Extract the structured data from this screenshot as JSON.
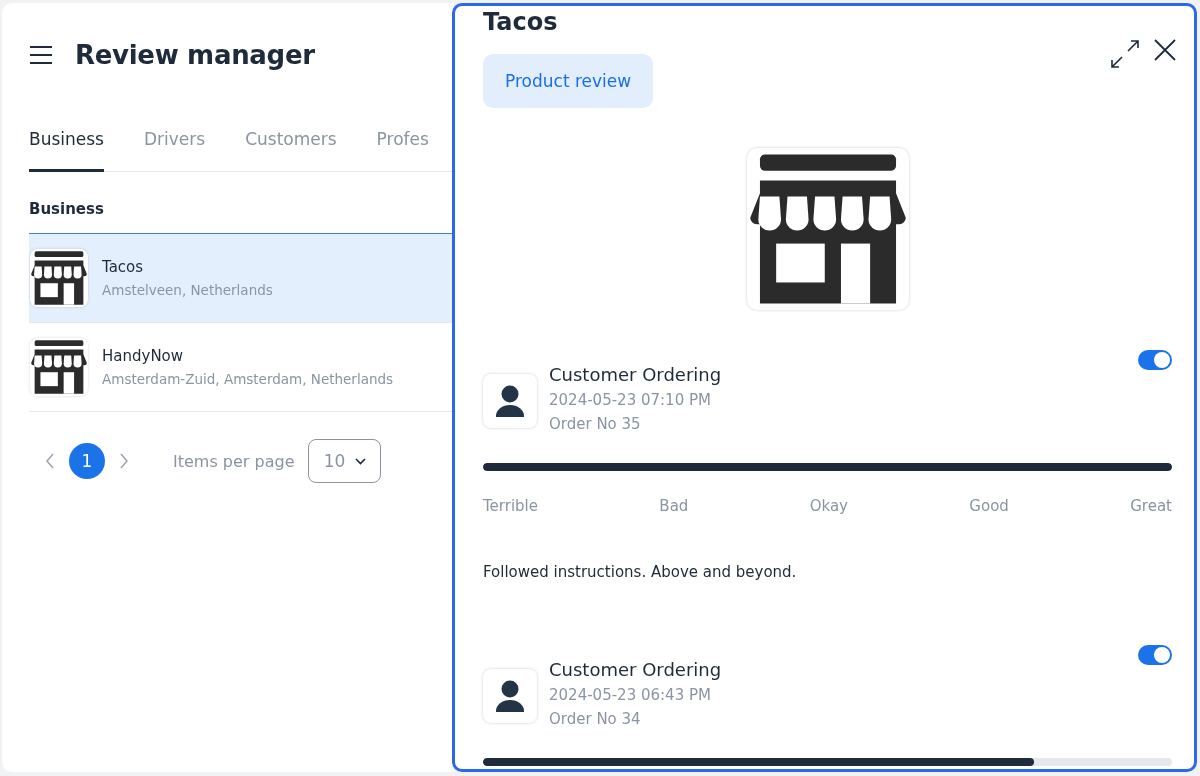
{
  "header": {
    "title": "Review manager"
  },
  "tabs": [
    {
      "label": "Business",
      "selected": true
    },
    {
      "label": "Drivers",
      "selected": false
    },
    {
      "label": "Customers",
      "selected": false
    },
    {
      "label": "Profes",
      "selected": false
    }
  ],
  "section_title": "Business",
  "businesses": [
    {
      "name": "Tacos",
      "location": "Amstelveen, Netherlands",
      "selected": true
    },
    {
      "name": "HandyNow",
      "location": "Amsterdam-Zuid, Amsterdam, Netherlands",
      "selected": false
    }
  ],
  "pagination": {
    "pages": [
      {
        "label": "1",
        "selected": true
      }
    ],
    "items_per_page_label": "Items per page",
    "items_per_page": "10"
  },
  "detail_panel": {
    "title": "Tacos",
    "tag": "Product review",
    "reviews": [
      {
        "name": "Customer Ordering",
        "date": "2024-05-23 07:10 PM",
        "order": "Order No 35",
        "on": true,
        "level": 1,
        "scale": [
          "Terrible",
          "Bad",
          "Okay",
          "Good",
          "Great"
        ],
        "comment": "Followed instructions. Above and beyond."
      },
      {
        "name": "Customer Ordering",
        "date": "2024-05-23 06:43 PM",
        "order": "Order No 34",
        "on": true,
        "level": 0.8
      }
    ]
  }
}
